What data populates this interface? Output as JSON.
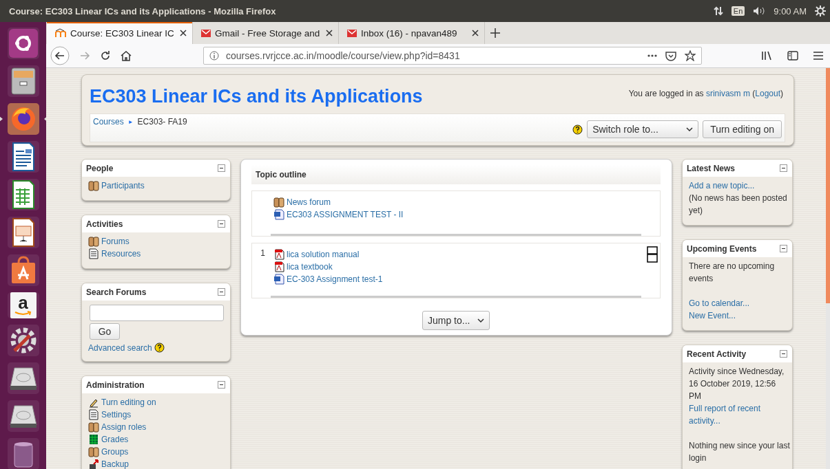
{
  "top_bar": {
    "title": "Course: EC303 Linear ICs and its Applications - Mozilla Firefox",
    "keyboard": "En",
    "time": "9:00 AM"
  },
  "launcher": [
    {
      "kind": "ubuntu",
      "selected": false
    },
    {
      "kind": "files",
      "selected": false
    },
    {
      "kind": "browser",
      "selected": true
    },
    {
      "kind": "writer",
      "selected": false
    },
    {
      "kind": "calc",
      "selected": false
    },
    {
      "kind": "impress",
      "selected": false
    },
    {
      "kind": "store",
      "selected": false
    },
    {
      "kind": "amazon",
      "label": "a",
      "selected": false
    },
    {
      "kind": "tools",
      "selected": false
    },
    {
      "kind": "drive",
      "selected": false
    },
    {
      "kind": "drive",
      "selected": false
    },
    {
      "kind": "trash",
      "selected": false
    }
  ],
  "tabs": [
    {
      "kind": "moodle",
      "label": "Course: EC303 Linear IC",
      "selected": true
    },
    {
      "kind": "mail",
      "label": "Gmail - Free Storage and",
      "selected": false
    },
    {
      "kind": "mail",
      "label": "Inbox (16) - npavan489",
      "selected": false
    }
  ],
  "address": "courses.rvrjcce.ac.in/moodle/course/view.php?id=8431",
  "course": {
    "title": "EC303 Linear ICs and its Applications",
    "login": {
      "prefix": "You are logged in as",
      "user": "srinivasm m",
      "open": "(",
      "logout": "Logout",
      "close": ")"
    },
    "breadcrumb": [
      {
        "label": "Courses",
        "kind": "link"
      },
      {
        "label": "EC303- FA19",
        "kind": "current"
      }
    ],
    "separator": "►",
    "switch_role": "Switch role to...",
    "edit_button": "Turn editing on"
  },
  "left_blocks": [
    {
      "title": "People",
      "kind": "list",
      "items": [
        {
          "kind": "people",
          "label": "Participants"
        }
      ]
    },
    {
      "title": "Activities",
      "kind": "list",
      "items": [
        {
          "kind": "people",
          "label": "Forums"
        },
        {
          "kind": "page",
          "label": "Resources"
        }
      ]
    },
    {
      "title": "Search Forums",
      "kind": "search",
      "go": "Go",
      "link": "Advanced search"
    },
    {
      "title": "Administration",
      "kind": "list",
      "items": [
        {
          "kind": "pencil",
          "label": "Turn editing on"
        },
        {
          "kind": "page",
          "label": "Settings"
        },
        {
          "kind": "people",
          "label": "Assign roles"
        },
        {
          "kind": "grid",
          "label": "Grades"
        },
        {
          "kind": "people",
          "label": "Groups"
        },
        {
          "kind": "backup",
          "label": "Backup"
        }
      ]
    }
  ],
  "topic_outline": {
    "title": "Topic outline",
    "sections": [
      {
        "items": [
          {
            "kind": "people",
            "label": "News forum"
          },
          {
            "kind": "doc",
            "label": "EC303 ASSIGNMENT TEST - II"
          }
        ]
      },
      {
        "number": "1",
        "items": [
          {
            "kind": "pdf",
            "label": "lica solution manual"
          },
          {
            "kind": "pdf",
            "label": "lica textbook"
          },
          {
            "kind": "doc",
            "label": "EC-303 Assignment test-1"
          }
        ]
      }
    ],
    "jump": "Jump to..."
  },
  "right_blocks": [
    {
      "title": "Latest News",
      "paragraphs": [
        [
          {
            "kind": "link",
            "text": "Add a new topic..."
          },
          {
            "kind": "text",
            "text": "(No news has been posted yet)"
          }
        ]
      ]
    },
    {
      "title": "Upcoming Events",
      "paragraphs": [
        [
          {
            "kind": "text",
            "text": "There are no upcoming events"
          }
        ],
        [
          {
            "kind": "link",
            "text": "Go to calendar..."
          },
          {
            "kind": "link",
            "text": "New Event..."
          }
        ]
      ]
    },
    {
      "title": "Recent Activity",
      "paragraphs": [
        [
          {
            "kind": "text",
            "text": "Activity since Wednesday, 16 October 2019, 12:56 PM"
          },
          {
            "kind": "link",
            "text": "Full report of recent activity..."
          }
        ],
        [
          {
            "kind": "text",
            "text": "Nothing new since your last login"
          }
        ]
      ]
    }
  ]
}
